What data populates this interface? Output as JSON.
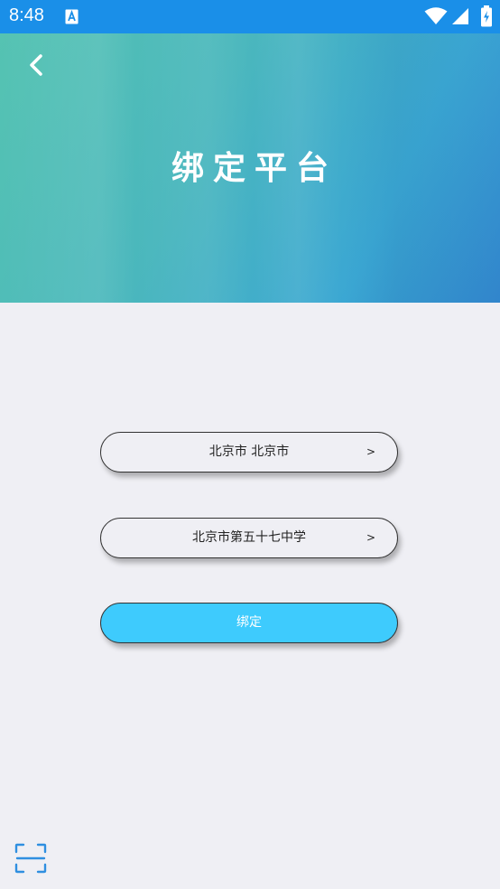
{
  "status_bar": {
    "time": "8:48",
    "icons": [
      "app-notification-icon",
      "wifi-icon",
      "signal-icon",
      "battery-charging-icon"
    ]
  },
  "header": {
    "title": "绑定平台",
    "back_icon": "chevron-left-icon"
  },
  "form": {
    "region_value": "北京市 北京市",
    "school_value": "北京市第五十七中学",
    "arrow": ">",
    "bind_label": "绑定"
  },
  "footer": {
    "scan_icon": "scan-icon"
  },
  "colors": {
    "status_bar": "#1a8fe8",
    "header_gradient_start": "#55c3b2",
    "header_gradient_end": "#3185cc",
    "background": "#efeff4",
    "bind_button": "#3ecbfd",
    "scan_icon": "#2f8fe0"
  }
}
